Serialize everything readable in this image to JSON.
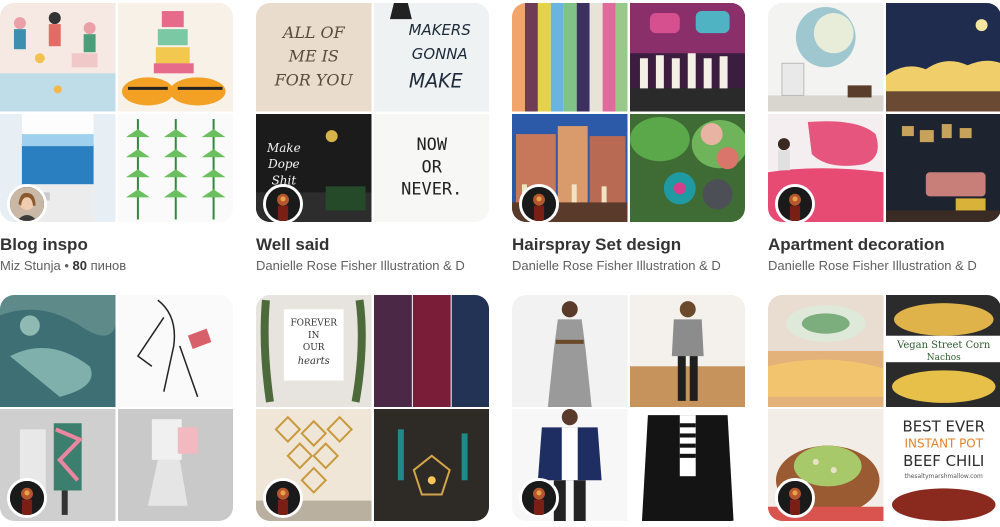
{
  "boards": [
    {
      "title": "Blog inspo",
      "owner": "Miz Stunja",
      "separator": " • ",
      "pin_count": "80",
      "pin_word": " пинов"
    },
    {
      "title": "Well said",
      "owner": "Danielle Rose Fisher Illustration & D"
    },
    {
      "title": "Hairspray Set design",
      "owner": "Danielle Rose Fisher Illustration & D"
    },
    {
      "title": "Apartment decoration",
      "owner": "Danielle Rose Fisher Illustration & D"
    }
  ],
  "images": {
    "well_said": {
      "line1": "MAKERS",
      "line2": "GONNA",
      "line3": "MAKE",
      "script1": "ALL OF",
      "script2": "ME IS",
      "script3": "FOR YOU",
      "wall1": "Make",
      "wall2": "Dope",
      "wall3": "Shit",
      "card1": "NOW",
      "card2": "OR",
      "card3": "NEVER."
    },
    "wedding_sign": {
      "l1": "FOREVER",
      "l2": "IN",
      "l3": "OUR",
      "l4": "hearts"
    },
    "food": {
      "corn1": "Vegan Street Corn",
      "corn2": "Nachos",
      "chili1": "BEST EVER",
      "chili2": "INSTANT POT",
      "chili3": "BEEF CHILI",
      "site": "thesaltymarshmallow.com"
    }
  },
  "colors": {
    "title": "#333333",
    "subtitle": "#5f5f5f",
    "background": "#ffffff"
  },
  "icons": [
    "avatar-woman",
    "avatar-man"
  ]
}
